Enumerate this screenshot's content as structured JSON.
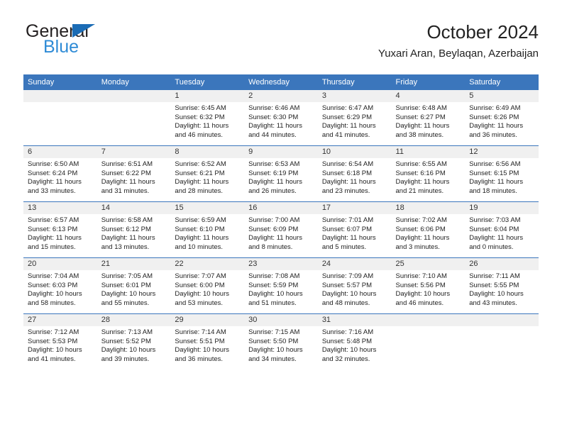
{
  "brand": {
    "name_top": "General",
    "name_bottom": "Blue",
    "triangle_icon": "blue-triangle-icon",
    "accent_color": "#1b6cb5",
    "secondary_color": "#2e8bd6"
  },
  "header": {
    "title": "October 2024",
    "subtitle": "Yuxari Aran, Beylaqan, Azerbaijan"
  },
  "theme": {
    "header_blue": "#3b76bc",
    "daynum_band": "#f0f0f0",
    "text": "#222222"
  },
  "calendar": {
    "weekday_headers": [
      "Sunday",
      "Monday",
      "Tuesday",
      "Wednesday",
      "Thursday",
      "Friday",
      "Saturday"
    ],
    "labels": {
      "sunrise": "Sunrise:",
      "sunset": "Sunset:",
      "daylight": "Daylight:"
    },
    "weeks": [
      [
        {
          "day": "",
          "sunrise": "",
          "sunset": "",
          "daylight_line1": "",
          "daylight_line2": ""
        },
        {
          "day": "",
          "sunrise": "",
          "sunset": "",
          "daylight_line1": "",
          "daylight_line2": ""
        },
        {
          "day": "1",
          "sunrise": "Sunrise: 6:45 AM",
          "sunset": "Sunset: 6:32 PM",
          "daylight_line1": "Daylight: 11 hours",
          "daylight_line2": "and 46 minutes."
        },
        {
          "day": "2",
          "sunrise": "Sunrise: 6:46 AM",
          "sunset": "Sunset: 6:30 PM",
          "daylight_line1": "Daylight: 11 hours",
          "daylight_line2": "and 44 minutes."
        },
        {
          "day": "3",
          "sunrise": "Sunrise: 6:47 AM",
          "sunset": "Sunset: 6:29 PM",
          "daylight_line1": "Daylight: 11 hours",
          "daylight_line2": "and 41 minutes."
        },
        {
          "day": "4",
          "sunrise": "Sunrise: 6:48 AM",
          "sunset": "Sunset: 6:27 PM",
          "daylight_line1": "Daylight: 11 hours",
          "daylight_line2": "and 38 minutes."
        },
        {
          "day": "5",
          "sunrise": "Sunrise: 6:49 AM",
          "sunset": "Sunset: 6:26 PM",
          "daylight_line1": "Daylight: 11 hours",
          "daylight_line2": "and 36 minutes."
        }
      ],
      [
        {
          "day": "6",
          "sunrise": "Sunrise: 6:50 AM",
          "sunset": "Sunset: 6:24 PM",
          "daylight_line1": "Daylight: 11 hours",
          "daylight_line2": "and 33 minutes."
        },
        {
          "day": "7",
          "sunrise": "Sunrise: 6:51 AM",
          "sunset": "Sunset: 6:22 PM",
          "daylight_line1": "Daylight: 11 hours",
          "daylight_line2": "and 31 minutes."
        },
        {
          "day": "8",
          "sunrise": "Sunrise: 6:52 AM",
          "sunset": "Sunset: 6:21 PM",
          "daylight_line1": "Daylight: 11 hours",
          "daylight_line2": "and 28 minutes."
        },
        {
          "day": "9",
          "sunrise": "Sunrise: 6:53 AM",
          "sunset": "Sunset: 6:19 PM",
          "daylight_line1": "Daylight: 11 hours",
          "daylight_line2": "and 26 minutes."
        },
        {
          "day": "10",
          "sunrise": "Sunrise: 6:54 AM",
          "sunset": "Sunset: 6:18 PM",
          "daylight_line1": "Daylight: 11 hours",
          "daylight_line2": "and 23 minutes."
        },
        {
          "day": "11",
          "sunrise": "Sunrise: 6:55 AM",
          "sunset": "Sunset: 6:16 PM",
          "daylight_line1": "Daylight: 11 hours",
          "daylight_line2": "and 21 minutes."
        },
        {
          "day": "12",
          "sunrise": "Sunrise: 6:56 AM",
          "sunset": "Sunset: 6:15 PM",
          "daylight_line1": "Daylight: 11 hours",
          "daylight_line2": "and 18 minutes."
        }
      ],
      [
        {
          "day": "13",
          "sunrise": "Sunrise: 6:57 AM",
          "sunset": "Sunset: 6:13 PM",
          "daylight_line1": "Daylight: 11 hours",
          "daylight_line2": "and 15 minutes."
        },
        {
          "day": "14",
          "sunrise": "Sunrise: 6:58 AM",
          "sunset": "Sunset: 6:12 PM",
          "daylight_line1": "Daylight: 11 hours",
          "daylight_line2": "and 13 minutes."
        },
        {
          "day": "15",
          "sunrise": "Sunrise: 6:59 AM",
          "sunset": "Sunset: 6:10 PM",
          "daylight_line1": "Daylight: 11 hours",
          "daylight_line2": "and 10 minutes."
        },
        {
          "day": "16",
          "sunrise": "Sunrise: 7:00 AM",
          "sunset": "Sunset: 6:09 PM",
          "daylight_line1": "Daylight: 11 hours",
          "daylight_line2": "and 8 minutes."
        },
        {
          "day": "17",
          "sunrise": "Sunrise: 7:01 AM",
          "sunset": "Sunset: 6:07 PM",
          "daylight_line1": "Daylight: 11 hours",
          "daylight_line2": "and 5 minutes."
        },
        {
          "day": "18",
          "sunrise": "Sunrise: 7:02 AM",
          "sunset": "Sunset: 6:06 PM",
          "daylight_line1": "Daylight: 11 hours",
          "daylight_line2": "and 3 minutes."
        },
        {
          "day": "19",
          "sunrise": "Sunrise: 7:03 AM",
          "sunset": "Sunset: 6:04 PM",
          "daylight_line1": "Daylight: 11 hours",
          "daylight_line2": "and 0 minutes."
        }
      ],
      [
        {
          "day": "20",
          "sunrise": "Sunrise: 7:04 AM",
          "sunset": "Sunset: 6:03 PM",
          "daylight_line1": "Daylight: 10 hours",
          "daylight_line2": "and 58 minutes."
        },
        {
          "day": "21",
          "sunrise": "Sunrise: 7:05 AM",
          "sunset": "Sunset: 6:01 PM",
          "daylight_line1": "Daylight: 10 hours",
          "daylight_line2": "and 55 minutes."
        },
        {
          "day": "22",
          "sunrise": "Sunrise: 7:07 AM",
          "sunset": "Sunset: 6:00 PM",
          "daylight_line1": "Daylight: 10 hours",
          "daylight_line2": "and 53 minutes."
        },
        {
          "day": "23",
          "sunrise": "Sunrise: 7:08 AM",
          "sunset": "Sunset: 5:59 PM",
          "daylight_line1": "Daylight: 10 hours",
          "daylight_line2": "and 51 minutes."
        },
        {
          "day": "24",
          "sunrise": "Sunrise: 7:09 AM",
          "sunset": "Sunset: 5:57 PM",
          "daylight_line1": "Daylight: 10 hours",
          "daylight_line2": "and 48 minutes."
        },
        {
          "day": "25",
          "sunrise": "Sunrise: 7:10 AM",
          "sunset": "Sunset: 5:56 PM",
          "daylight_line1": "Daylight: 10 hours",
          "daylight_line2": "and 46 minutes."
        },
        {
          "day": "26",
          "sunrise": "Sunrise: 7:11 AM",
          "sunset": "Sunset: 5:55 PM",
          "daylight_line1": "Daylight: 10 hours",
          "daylight_line2": "and 43 minutes."
        }
      ],
      [
        {
          "day": "27",
          "sunrise": "Sunrise: 7:12 AM",
          "sunset": "Sunset: 5:53 PM",
          "daylight_line1": "Daylight: 10 hours",
          "daylight_line2": "and 41 minutes."
        },
        {
          "day": "28",
          "sunrise": "Sunrise: 7:13 AM",
          "sunset": "Sunset: 5:52 PM",
          "daylight_line1": "Daylight: 10 hours",
          "daylight_line2": "and 39 minutes."
        },
        {
          "day": "29",
          "sunrise": "Sunrise: 7:14 AM",
          "sunset": "Sunset: 5:51 PM",
          "daylight_line1": "Daylight: 10 hours",
          "daylight_line2": "and 36 minutes."
        },
        {
          "day": "30",
          "sunrise": "Sunrise: 7:15 AM",
          "sunset": "Sunset: 5:50 PM",
          "daylight_line1": "Daylight: 10 hours",
          "daylight_line2": "and 34 minutes."
        },
        {
          "day": "31",
          "sunrise": "Sunrise: 7:16 AM",
          "sunset": "Sunset: 5:48 PM",
          "daylight_line1": "Daylight: 10 hours",
          "daylight_line2": "and 32 minutes."
        },
        {
          "day": "",
          "sunrise": "",
          "sunset": "",
          "daylight_line1": "",
          "daylight_line2": ""
        },
        {
          "day": "",
          "sunrise": "",
          "sunset": "",
          "daylight_line1": "",
          "daylight_line2": ""
        }
      ]
    ]
  }
}
